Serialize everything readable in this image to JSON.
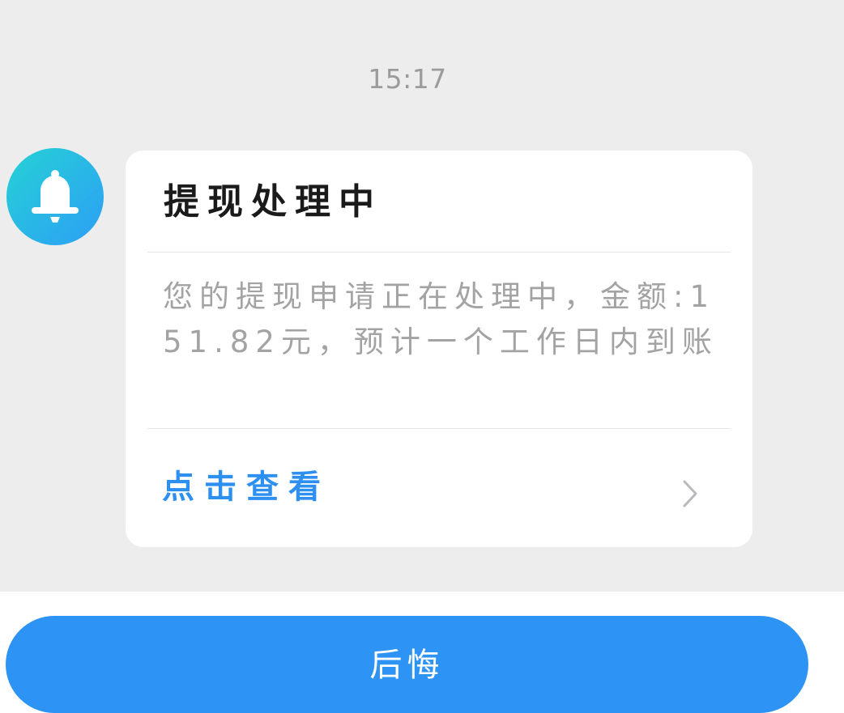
{
  "chat": {
    "timestamp": "15:17"
  },
  "avatar": {
    "icon": "bell-icon",
    "gradient": [
      "#25d2d4",
      "#2d9ef6"
    ]
  },
  "card": {
    "title": "提现处理中",
    "body": "您的提现申请正在处理中，金额:151.82元，预计一个工作日内到账",
    "link_label": "点击查看",
    "link_icon": "chevron-right-icon"
  },
  "action_bar": {
    "label": "后悔"
  },
  "colors": {
    "chat_background": "#ededed",
    "card_background": "#ffffff",
    "title_text": "#1a1a1a",
    "body_text": "#a3a3a3",
    "link_text": "#2d90f0",
    "timestamp_text": "#9b9b9b",
    "action_bar": "#2d94f6"
  }
}
